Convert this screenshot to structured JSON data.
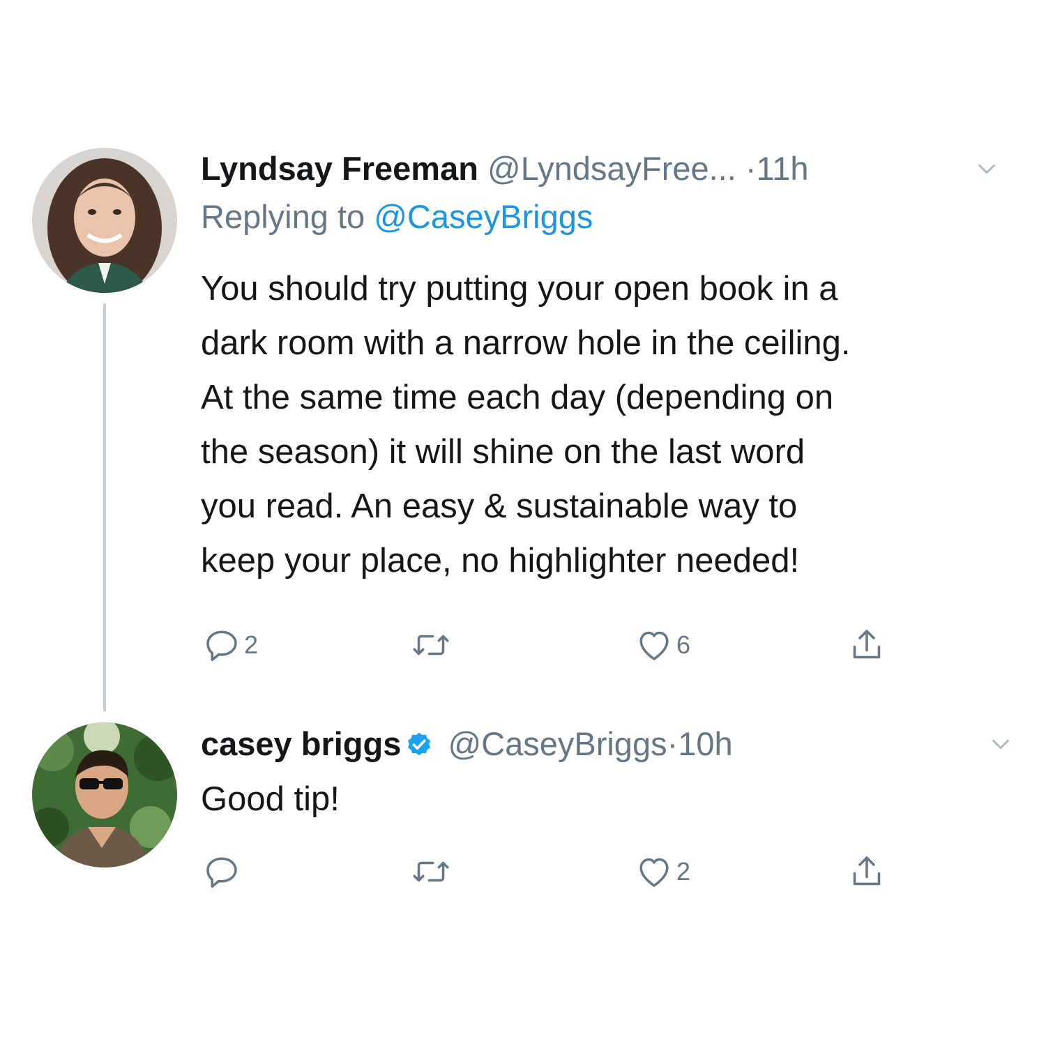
{
  "tweets": [
    {
      "name": "Lyndsay Freeman",
      "handle": "@LyndsayFree...",
      "separator": "·",
      "time": "11h",
      "verified": false,
      "replying_prefix": "Replying to ",
      "replying_handle": "@CaseyBriggs",
      "body_lines": [
        "You should try putting your open book in a",
        "dark room with a narrow hole in the ceiling.",
        "At the same time each day (depending on",
        "the season) it will shine on the last word",
        "you read. An easy & sustainable way to",
        "keep your place, no highlighter needed!"
      ],
      "replies": "2",
      "retweets": "",
      "likes": "6"
    },
    {
      "name": "casey briggs",
      "handle": "@CaseyBriggs",
      "separator": "·",
      "time": "10h",
      "verified": true,
      "body_lines": [
        "Good tip!"
      ],
      "replies": "",
      "retweets": "",
      "likes": "2"
    }
  ],
  "icons": {
    "reply": "reply-icon",
    "retweet": "retweet-icon",
    "like": "heart-icon",
    "share": "share-icon",
    "caret": "chevron-down-icon",
    "verified": "verified-badge-icon"
  },
  "colors": {
    "text": "#14171a",
    "secondary": "#657786",
    "link": "#1b95e0",
    "thread_line": "#c4cfd6",
    "verified": "#1da1f2"
  }
}
